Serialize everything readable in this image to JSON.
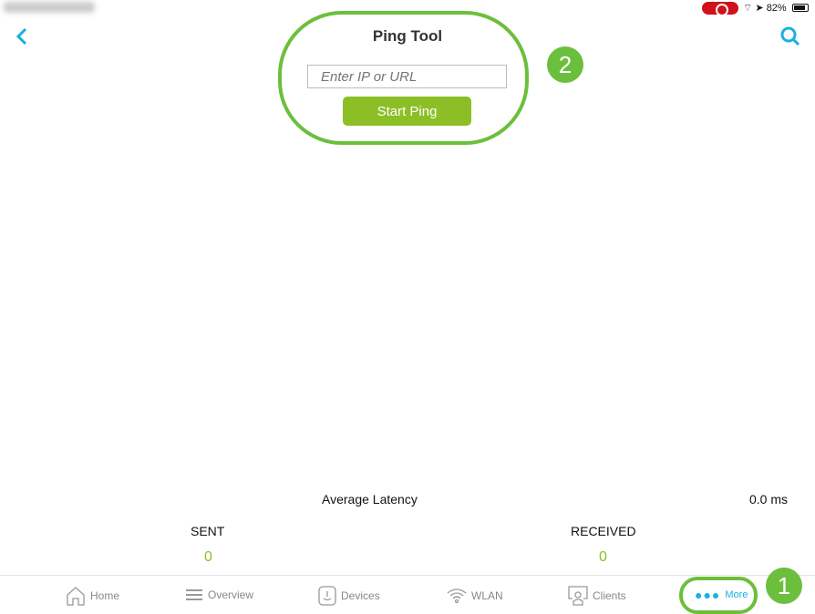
{
  "status": {
    "battery": "82%"
  },
  "header": {
    "title": "Ping Tool"
  },
  "ping": {
    "placeholder": "Enter IP or URL",
    "start_label": "Start Ping"
  },
  "stats": {
    "avg_latency_label": "Average Latency",
    "avg_latency_value": "0.0 ms",
    "sent_label": "SENT",
    "sent_value": "0",
    "received_label": "RECEIVED",
    "received_value": "0"
  },
  "tabs": [
    {
      "label": "Home"
    },
    {
      "label": "Overview"
    },
    {
      "label": "Devices"
    },
    {
      "label": "WLAN"
    },
    {
      "label": "Clients"
    },
    {
      "label": "More"
    }
  ],
  "annotations": {
    "one": "1",
    "two": "2"
  },
  "colors": {
    "accent": "#1ab0e0",
    "green": "#8cbf26",
    "highlight": "#6cbf3c"
  }
}
